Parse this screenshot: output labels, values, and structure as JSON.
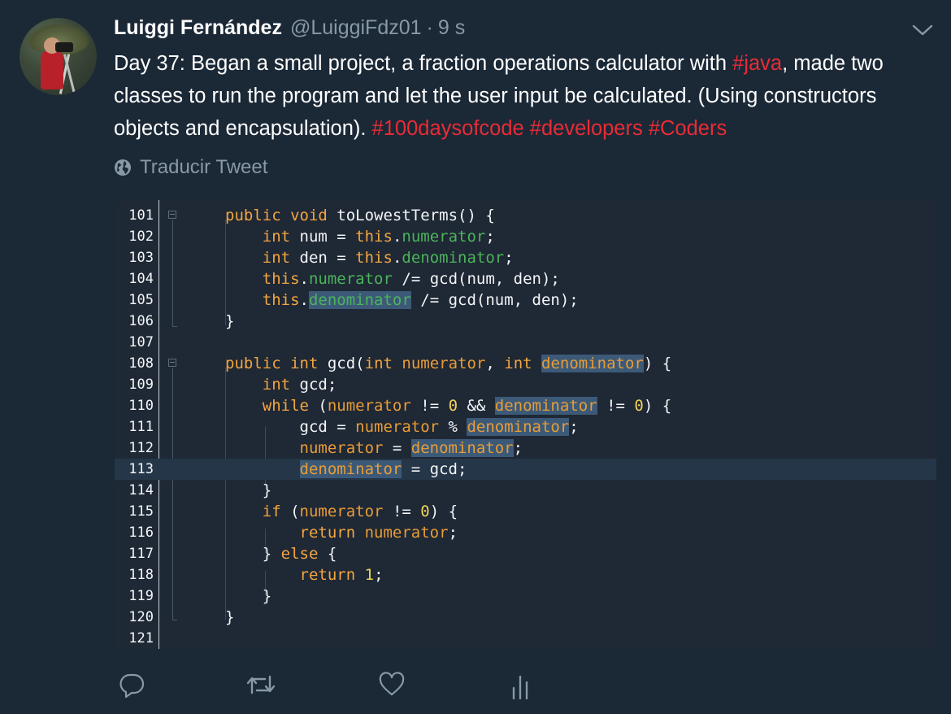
{
  "tweet": {
    "author_name": "Luiggi Fernández",
    "author_handle": "@LuiggiFdz01",
    "separator": "·",
    "timestamp": "9 s",
    "text_part1": "Day 37: Began a small project, a fraction operations calculator with ",
    "hashtag_java": "#java",
    "text_part2": ", made two classes to run the program and let the user input be calculated. (Using constructors objects and encapsulation). ",
    "hashtags": [
      "#100daysofcode",
      "#developers",
      "#Coders"
    ],
    "translate_label": "Traducir Tweet"
  },
  "code": {
    "line_numbers": [
      "101",
      "102",
      "103",
      "104",
      "105",
      "106",
      "107",
      "108",
      "109",
      "110",
      "111",
      "112",
      "113",
      "114",
      "115",
      "116",
      "117",
      "118",
      "119",
      "120",
      "121"
    ]
  },
  "icons": {
    "avatar": "profile-photo",
    "menu": "chevron-down-icon",
    "translate": "globe-icon",
    "reply": "reply-icon",
    "retweet": "retweet-icon",
    "like": "heart-icon",
    "analytics": "analytics-icon"
  },
  "colors": {
    "background": "#1b2836",
    "hashtag": "#e82c36",
    "muted": "#8899a6",
    "code_background": "#1f2835"
  }
}
